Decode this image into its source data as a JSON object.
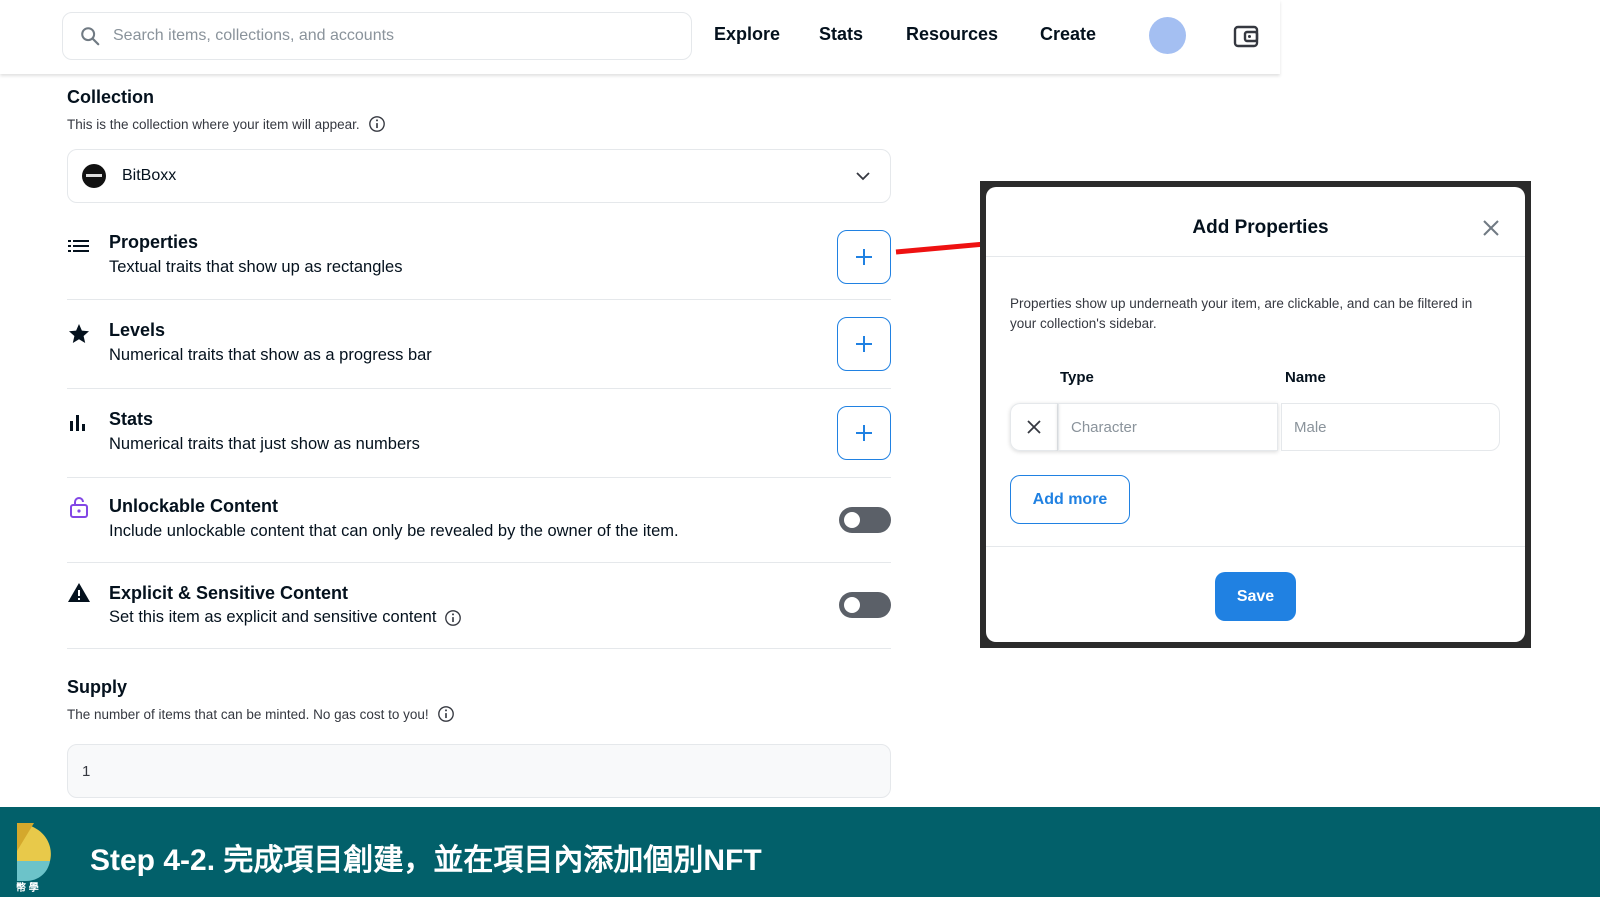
{
  "nav": {
    "search_placeholder": "Search items, collections, and accounts",
    "items": [
      "Explore",
      "Stats",
      "Resources",
      "Create"
    ]
  },
  "collection": {
    "title": "Collection",
    "subtitle": "This is the collection where your item will appear.",
    "selected": "BitBoxx"
  },
  "traits": [
    {
      "title": "Properties",
      "desc": "Textual traits that show up as rectangles",
      "icon": "list-icon"
    },
    {
      "title": "Levels",
      "desc": "Numerical traits that show as a progress bar",
      "icon": "star-icon"
    },
    {
      "title": "Stats",
      "desc": "Numerical traits that just show as numbers",
      "icon": "bar-chart-icon"
    }
  ],
  "toggles": [
    {
      "title": "Unlockable Content",
      "desc": "Include unlockable content that can only be revealed by the owner of the item.",
      "icon": "lock-icon"
    },
    {
      "title": "Explicit & Sensitive Content",
      "desc": "Set this item as explicit and sensitive content",
      "icon": "warning-icon"
    }
  ],
  "supply": {
    "title": "Supply",
    "subtitle": "The number of items that can be minted. No gas cost to you!",
    "value": "1"
  },
  "modal": {
    "title": "Add Properties",
    "description": "Properties show up underneath your item, are clickable, and can be filtered in your collection's sidebar.",
    "col_type": "Type",
    "col_name": "Name",
    "type_placeholder": "Character",
    "name_placeholder": "Male",
    "add_more": "Add more",
    "save": "Save"
  },
  "banner": {
    "title": "Step 4-2. 完成項目創建，並在項目內添加個別NFT",
    "logo_text": "幣 學"
  },
  "colors": {
    "accent": "#2081e2",
    "banner": "#02606a",
    "arrow": "#ee1111"
  }
}
